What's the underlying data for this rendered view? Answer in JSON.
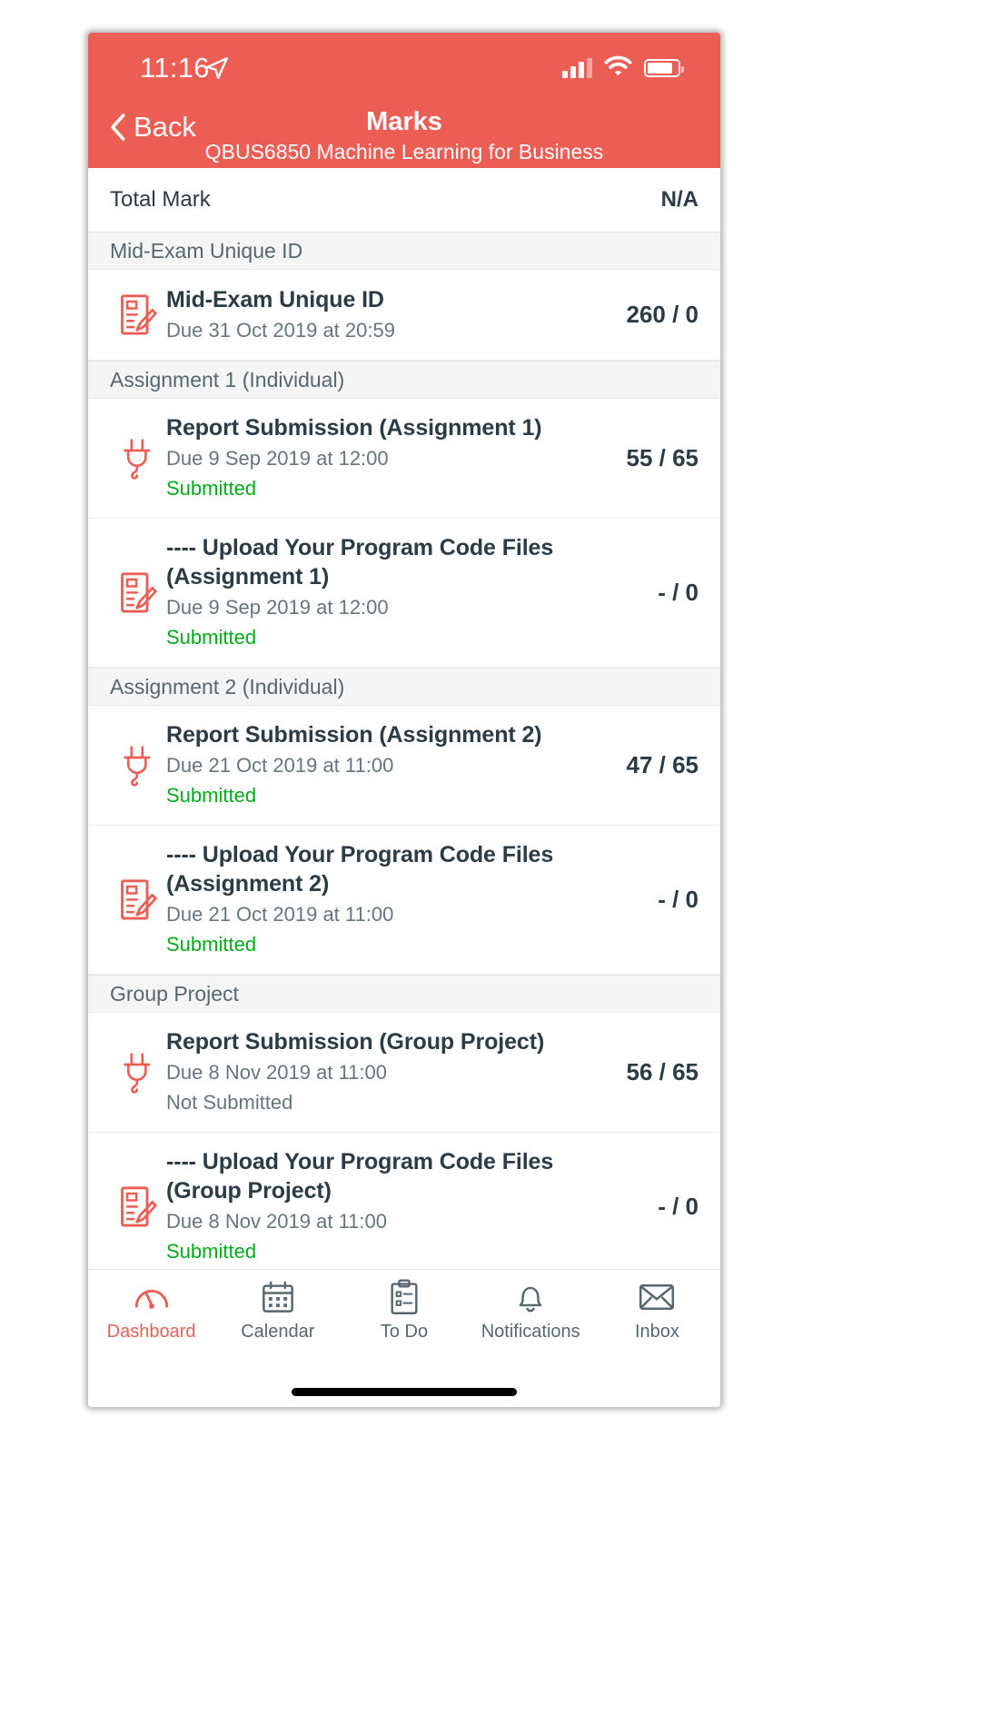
{
  "theme": {
    "brand_color": "#ec5e54",
    "submitted_color": "#00ac18",
    "text_color": "#2d3b45"
  },
  "status_bar": {
    "time": "11:16",
    "location_icon": "location-arrow-icon",
    "signal_icon": "cellular-signal-icon",
    "wifi_icon": "wifi-icon",
    "battery_icon": "battery-icon"
  },
  "nav": {
    "back_label": "Back",
    "back_icon": "chevron-left-icon",
    "title": "Marks",
    "subtitle": "QBUS6850 Machine Learning for Business"
  },
  "total": {
    "label": "Total Mark",
    "value": "N/A"
  },
  "groups": [
    {
      "section": "Mid-Exam Unique ID",
      "rows": [
        {
          "icon": "document-edit-icon",
          "title": "Mid-Exam Unique ID",
          "due": "Due 31 Oct 2019 at 20:59",
          "status": "",
          "status_kind": "none",
          "score": "260 / 0"
        }
      ]
    },
    {
      "section": "Assignment 1 (Individual)",
      "rows": [
        {
          "icon": "lti-plug-icon",
          "title": "Report Submission (Assignment 1)",
          "due": "Due 9 Sep 2019 at 12:00",
          "status": "Submitted",
          "status_kind": "submitted",
          "score": "55 / 65"
        },
        {
          "icon": "document-edit-icon",
          "title": " ---- Upload Your Program Code Files (Assignment 1)",
          "due": "Due 9 Sep 2019 at 12:00",
          "status": "Submitted",
          "status_kind": "submitted",
          "score": "- / 0"
        }
      ]
    },
    {
      "section": "Assignment 2 (Individual)",
      "rows": [
        {
          "icon": "lti-plug-icon",
          "title": "Report Submission (Assignment 2)",
          "due": "Due 21 Oct 2019 at 11:00",
          "status": "Submitted",
          "status_kind": "submitted",
          "score": "47 / 65"
        },
        {
          "icon": "document-edit-icon",
          "title": "---- Upload Your Program Code Files (Assignment 2)",
          "due": "Due 21 Oct 2019 at 11:00",
          "status": "Submitted",
          "status_kind": "submitted",
          "score": "- / 0"
        }
      ]
    },
    {
      "section": "Group Project",
      "rows": [
        {
          "icon": "lti-plug-icon",
          "title": "Report Submission (Group Project)",
          "due": "Due 8 Nov 2019 at 11:00",
          "status": "Not Submitted",
          "status_kind": "not-submitted",
          "score": "56 / 65"
        },
        {
          "icon": "document-edit-icon",
          "title": "---- Upload Your Program Code Files (Group Project)",
          "due": "Due 8 Nov 2019 at 11:00",
          "status": "Submitted",
          "status_kind": "submitted",
          "score": "- / 0"
        }
      ]
    }
  ],
  "tabs": [
    {
      "label": "Dashboard",
      "icon": "dashboard-gauge-icon",
      "active": true
    },
    {
      "label": "Calendar",
      "icon": "calendar-icon",
      "active": false
    },
    {
      "label": "To Do",
      "icon": "clipboard-list-icon",
      "active": false
    },
    {
      "label": "Notifications",
      "icon": "bell-icon",
      "active": false
    },
    {
      "label": "Inbox",
      "icon": "envelope-icon",
      "active": false
    }
  ]
}
